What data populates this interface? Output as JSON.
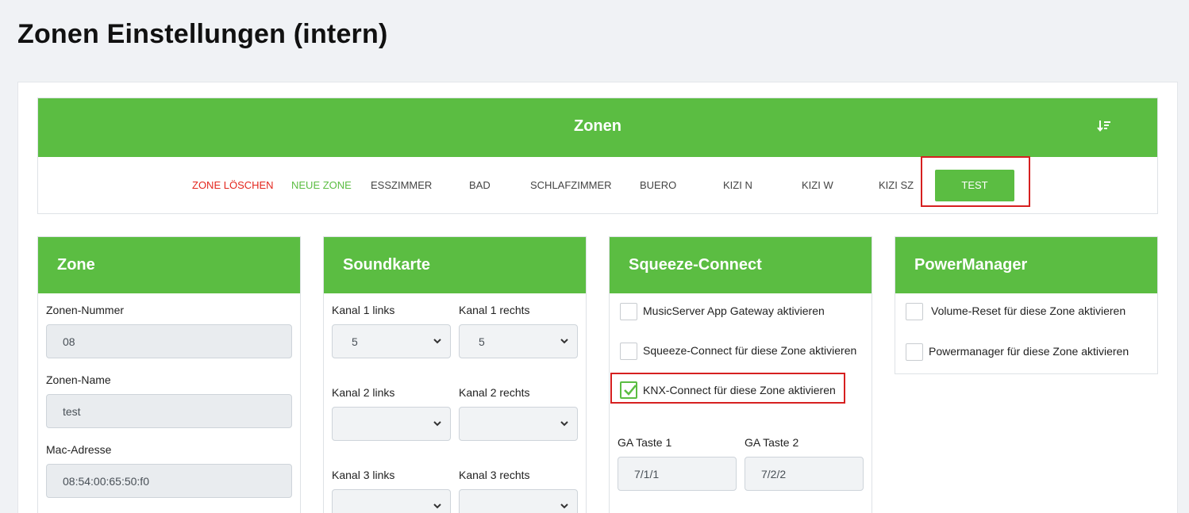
{
  "page_title": "Zonen Einstellungen (intern)",
  "zonen": {
    "title": "Zonen",
    "sort_icon": "sort-descending-icon",
    "tabs": [
      {
        "label": "ZONE LÖSCHEN",
        "type": "delete"
      },
      {
        "label": "NEUE ZONE",
        "type": "new"
      },
      {
        "label": "ESSZIMMER",
        "type": "zone"
      },
      {
        "label": "BAD",
        "type": "zone"
      },
      {
        "label": "SCHLAFZIMMER",
        "type": "zone"
      },
      {
        "label": "BUERO",
        "type": "zone"
      },
      {
        "label": "KIZI N",
        "type": "zone"
      },
      {
        "label": "KIZI W",
        "type": "zone"
      },
      {
        "label": "KIZI SZ",
        "type": "zone"
      },
      {
        "label": "TEST",
        "type": "active"
      }
    ]
  },
  "zone_panel": {
    "title": "Zone",
    "number_label": "Zonen-Nummer",
    "number_value": "08",
    "name_label": "Zonen-Name",
    "name_value": "test",
    "mac_label": "Mac-Adresse",
    "mac_value": "08:54:00:65:50:f0"
  },
  "soundkarte": {
    "title": "Soundkarte",
    "k1_left_label": "Kanal 1 links",
    "k1_left_value": "5",
    "k1_right_label": "Kanal 1 rechts",
    "k1_right_value": "5",
    "k2_left_label": "Kanal 2 links",
    "k2_left_value": "",
    "k2_right_label": "Kanal 2 rechts",
    "k2_right_value": "",
    "k3_left_label": "Kanal 3 links",
    "k3_left_value": "",
    "k3_right_label": "Kanal 3 rechts",
    "k3_right_value": ""
  },
  "squeeze": {
    "title": "Squeeze-Connect",
    "cb1_label": "MusicServer App Gateway aktivieren",
    "cb1_checked": false,
    "cb2_label": "Squeeze-Connect für diese Zone aktivieren",
    "cb2_checked": false,
    "cb3_label": "KNX-Connect für diese Zone aktivieren",
    "cb3_checked": true,
    "ga1_label": "GA Taste 1",
    "ga1_value": "7/1/1",
    "ga2_label": "GA Taste 2",
    "ga2_value": "7/2/2"
  },
  "power": {
    "title": "PowerManager",
    "cb1_label": "Volume-Reset für diese Zone aktivieren",
    "cb1_checked": false,
    "cb2_label": "Powermanager für diese Zone aktivieren",
    "cb2_checked": false
  },
  "colors": {
    "accent": "#5bbd42",
    "danger": "#e3261d",
    "highlight": "#d62020"
  }
}
